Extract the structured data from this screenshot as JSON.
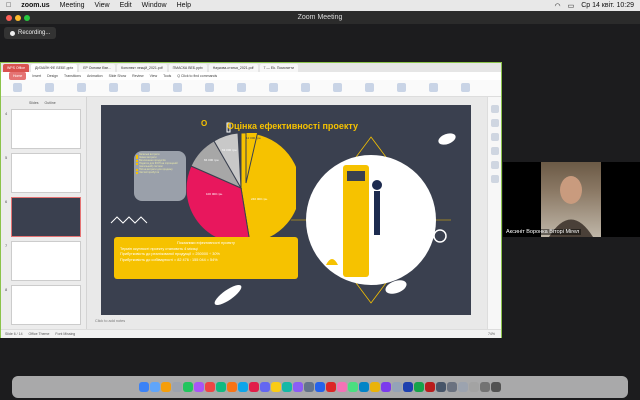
{
  "menubar": {
    "app": "zoom.us",
    "items": [
      "Meeting",
      "View",
      "Edit",
      "Window",
      "Help"
    ],
    "clock": "Ср 14 квіт.  10:29"
  },
  "window": {
    "title": "Zoom Meeting",
    "recording": "Recording..."
  },
  "wps": {
    "tabs": [
      "WPS Office",
      "ДИЗАЙН ФЕ БЕБЕ.pptx",
      "EP Основи бізн...",
      "Конспект лекцій_2021.pdf",
      "ПМАСКА ВЕБ.pptx",
      "Наукова-статья_2021.pdf",
      "7 — Ek. Помогатти"
    ],
    "menu": [
      "Home",
      "Insert",
      "Design",
      "Transitions",
      "Animation",
      "Slide Show",
      "Review",
      "View",
      "Tools",
      "Q Click to find commands"
    ],
    "ribbon_items": [
      "Paste",
      "Format Painter",
      "New Slide",
      "Layout",
      "Reset",
      "Section",
      "Text Box",
      "Shapes",
      "Arrange",
      "Outline",
      "Replace",
      "Select",
      "Picture",
      "Slide Show",
      "Transition"
    ],
    "panel_tabs": [
      "Slides",
      "Outline"
    ],
    "slide_numbers": [
      "4",
      "5",
      "6",
      "7",
      "8"
    ],
    "notes_placeholder": "Click to add notes",
    "status": {
      "slide_info": "Slide 6 / 14",
      "theme": "Office Theme",
      "autobackup": "Font Missing",
      "zoom": "74%"
    }
  },
  "slide": {
    "title": "Оцінка ефективності проекту",
    "bullet_marker": "О",
    "legend": [
      {
        "label": "Загальні витрати",
        "color": "#f6c200"
      },
      {
        "label": "Змінні витрати",
        "color": "#f6c200"
      },
      {
        "label": "Виплачення продуктів",
        "color": "#f6c200"
      },
      {
        "label": "Податок для ФОП на спрощеній (загальний) системі",
        "color": "#f6c200"
      },
      {
        "label": "ПН на витрати для продажу",
        "color": "#f6c200"
      },
      {
        "label": "Чистий прибуток",
        "color": "#f6c200"
      }
    ],
    "pie_labels": {
      "big": "240 000 грн.",
      "pink": "100 000 грн.",
      "gray1": "84 000 грн.",
      "gray2": "63 000 грн.",
      "small": "12 000 грн."
    },
    "info": {
      "header": "Показники ефективності проекту",
      "lines": [
        "Термін окупності проекту становить 4 місяці",
        "Прибутковість до реалізованої продукції = 250000 ÷ 30%",
        "Прибутковість до собівартості = 82 476 : 155 044 = 54%"
      ]
    }
  },
  "speaker": {
    "name": "Аксиніт Воронка Віторі Мігел"
  },
  "colors": {
    "accent": "#f6c200",
    "slide_bg": "#3a404f",
    "pink": "#e8175d"
  }
}
